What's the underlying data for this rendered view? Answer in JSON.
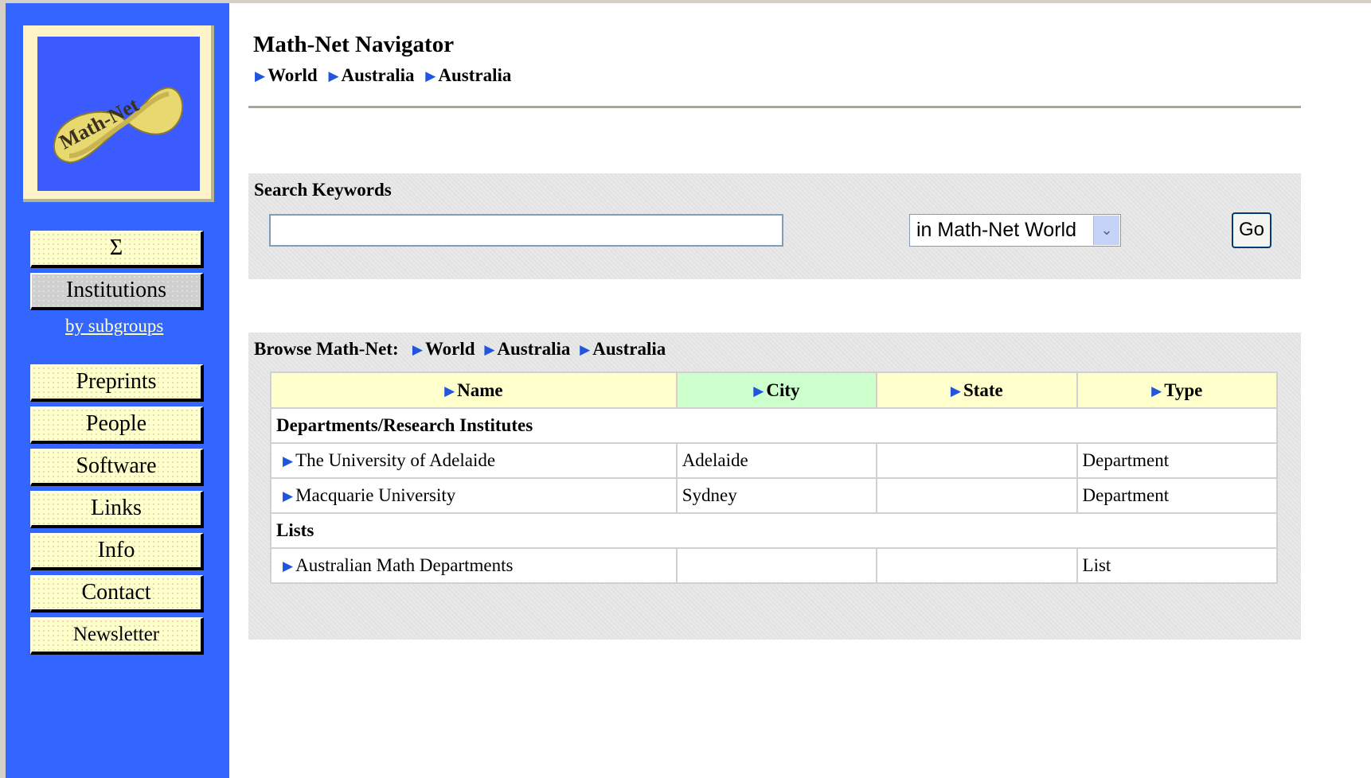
{
  "sidebar": {
    "logo_text": "Math-Net",
    "sigma_label": "Σ",
    "institutions_label": "Institutions",
    "subgroups_link": "by subgroups",
    "items": [
      {
        "label": "Preprints"
      },
      {
        "label": "People"
      },
      {
        "label": "Software"
      },
      {
        "label": "Links"
      },
      {
        "label": "Info"
      },
      {
        "label": "Contact"
      },
      {
        "label": "Newsletter"
      }
    ]
  },
  "header": {
    "title": "Math-Net Navigator",
    "breadcrumb": [
      "World",
      "Australia",
      "Australia"
    ]
  },
  "search": {
    "label": "Search Keywords",
    "value": "",
    "scope_selected": "in Math-Net World",
    "go_label": "Go"
  },
  "browse": {
    "label": "Browse Math-Net:",
    "breadcrumb": [
      "World",
      "Australia",
      "Australia"
    ],
    "columns": [
      "Name",
      "City",
      "State",
      "Type"
    ],
    "sorted_column": "City",
    "groups": [
      {
        "title": "Departments/Research Institutes",
        "rows": [
          {
            "name": "The University of Adelaide",
            "city": "Adelaide",
            "state": "",
            "type": "Department"
          },
          {
            "name": "Macquarie University",
            "city": "Sydney",
            "state": "",
            "type": "Department"
          }
        ]
      },
      {
        "title": "Lists",
        "rows": [
          {
            "name": "Australian Math Departments",
            "city": "",
            "state": "",
            "type": "List"
          }
        ]
      }
    ]
  },
  "colors": {
    "sidebar_bg": "#3366ff",
    "button_bg": "#ffffcc",
    "header_cell": "#ffffcc",
    "sorted_header_cell": "#ccffcc",
    "arrow": "#2255dd"
  }
}
